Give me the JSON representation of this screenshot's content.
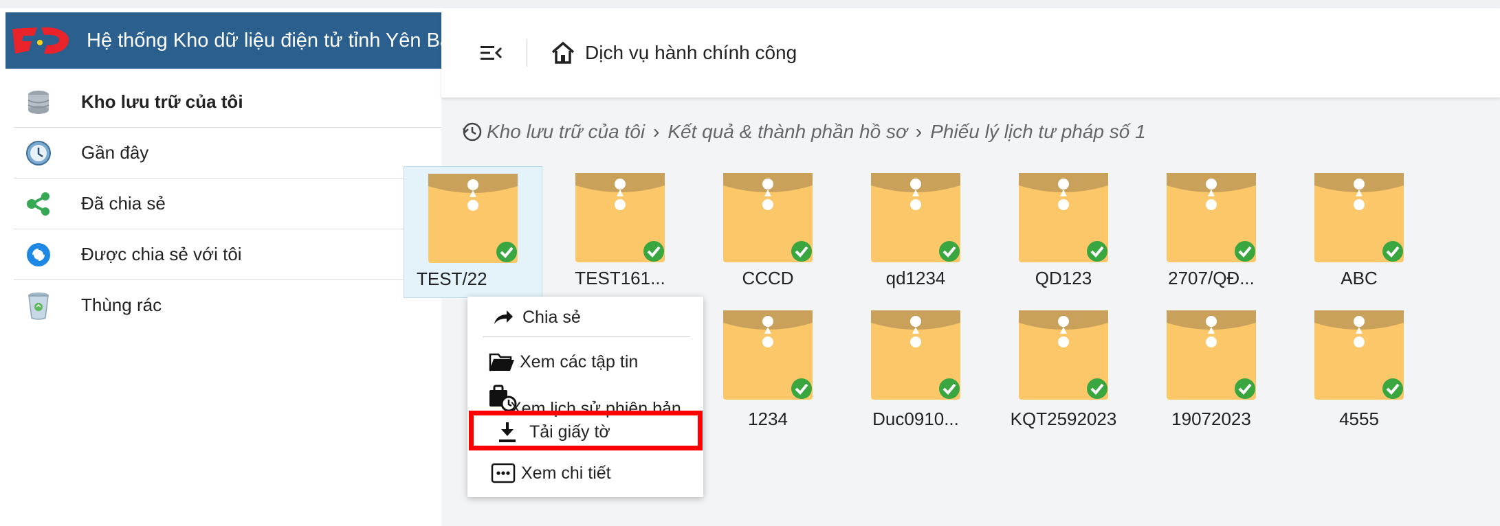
{
  "app": {
    "title": "Hệ thống Kho dữ liệu điện tử tỉnh Yên Bái"
  },
  "sidebar": {
    "items": [
      {
        "label": "Kho lưu trữ của tôi",
        "icon": "database-icon"
      },
      {
        "label": "Gần đây",
        "icon": "clock-icon"
      },
      {
        "label": "Đã chia sẻ",
        "icon": "share-icon"
      },
      {
        "label": "Được chia sẻ với tôi",
        "icon": "shared-with-me-icon"
      },
      {
        "label": "Thùng rác",
        "icon": "trash-icon"
      }
    ]
  },
  "header": {
    "title": "Dịch vụ hành chính công"
  },
  "breadcrumb": [
    "Kho lưu trữ của tôi",
    "Kết quả & thành phần hồ sơ",
    "Phiếu lý lịch tư pháp số 1"
  ],
  "folders": {
    "row1": [
      "TEST/22",
      "TEST161...",
      "CCCD",
      "qd1234",
      "QD123",
      "2707/QĐ...",
      "ABC"
    ],
    "row2": [
      "1234",
      "Duc0910...",
      "KQT2592023",
      "19072023",
      "4555"
    ]
  },
  "context_menu": {
    "items": [
      {
        "label": "Chia sẻ",
        "icon": "share-arrow-icon"
      },
      {
        "label": "Xem các tập tin",
        "icon": "folder-open-icon"
      },
      {
        "label": "Xem lịch sử phiên bản",
        "icon": "history-icon"
      },
      {
        "label": "Tải giấy tờ",
        "icon": "download-icon"
      },
      {
        "label": "Xem chi tiết",
        "icon": "details-icon"
      }
    ]
  },
  "colors": {
    "header_bg": "#2b5f8e",
    "folder": "#fcc769",
    "folder_flap": "#c9a15a",
    "check": "#3aa640",
    "highlight": "#ff0000"
  }
}
